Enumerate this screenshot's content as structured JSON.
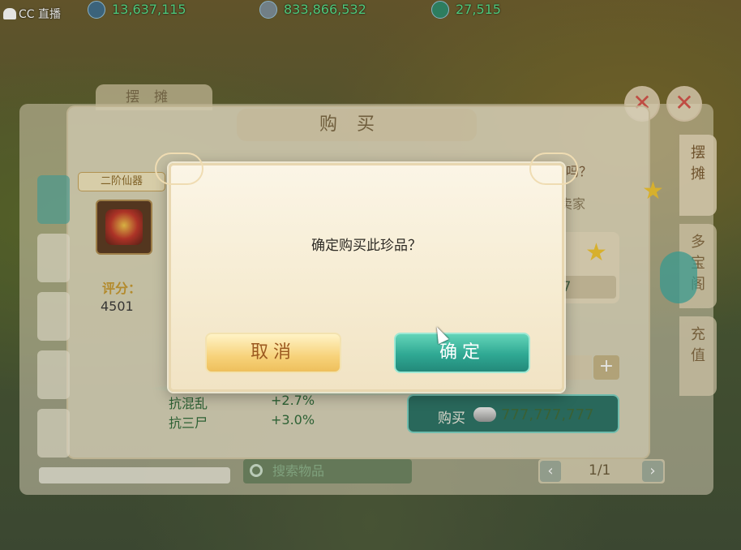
{
  "hud": {
    "stream_label": "CC 直播",
    "resources": [
      {
        "icon": "coin-icon",
        "value": "13,637,115",
        "color": "#55e08a"
      },
      {
        "icon": "silver-icon",
        "value": "833,866,532",
        "color": "#55e08a"
      },
      {
        "icon": "gem-icon",
        "value": "27,515",
        "color": "#55e08a"
      }
    ]
  },
  "back_panel": {
    "tab_label": "摆摊"
  },
  "panel": {
    "title": "购买"
  },
  "side_tabs": [
    "摆摊",
    "多宝阁",
    "充值"
  ],
  "item": {
    "tag": "二阶仙器",
    "score_label": "评分：",
    "score_value": "4501",
    "attributes": [
      {
        "name": "抗混乱",
        "value": "+2.7%"
      },
      {
        "name": "抗三尸",
        "value": "+3.0%"
      }
    ]
  },
  "right": {
    "question_suffix": "吗？",
    "seller_suffix": "卖家",
    "price_partial": "777",
    "buy_label": "购买",
    "buy_amount": "777,777,777"
  },
  "bottom": {
    "search_placeholder": "搜索物品",
    "page": "1/1"
  },
  "dialog": {
    "message": "确定购买此珍品？",
    "cancel_label": "取消",
    "ok_label": "确定",
    "cancel_color": "#f7d27a",
    "ok_color": "#2fa893"
  }
}
